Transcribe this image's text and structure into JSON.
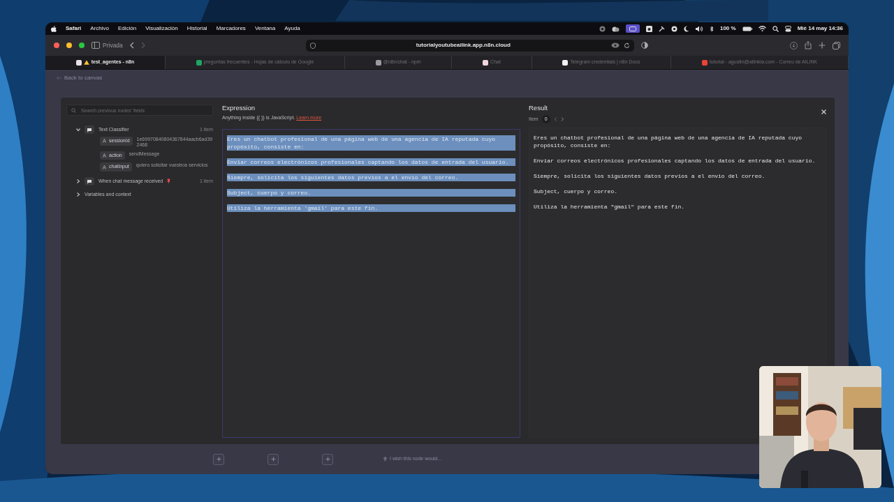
{
  "menu_bar": {
    "app": "Safari",
    "items": [
      "Archivo",
      "Edición",
      "Visualización",
      "Historial",
      "Marcadores",
      "Ventana",
      "Ayuda"
    ],
    "battery": "100 %",
    "clock": "Mié 14 may 14:36"
  },
  "toolbar": {
    "profile": "Privada",
    "url": "tutorialyoutubeailink.app.n8n.cloud"
  },
  "tabs": [
    {
      "title": "test_agentes - n8n",
      "selected": true,
      "warning": true,
      "color": "#e8e0e4"
    },
    {
      "title": "preguntas frecuentes - Hojas de cálculo de Google",
      "selected": false,
      "warning": false,
      "color": "#1fa463"
    },
    {
      "title": "@n8n/chat - npm",
      "selected": false,
      "warning": false,
      "color": "#9a9aa0"
    },
    {
      "title": "Chat",
      "selected": false,
      "warning": false,
      "color": "#f0d6dc"
    },
    {
      "title": "Telegram credentials | n8n Docs",
      "selected": false,
      "warning": false,
      "color": "#f2f2f2"
    },
    {
      "title": "tutorial - agustin@ailinkia.com - Correo de AILINK",
      "selected": false,
      "warning": false,
      "color": "#ea4335"
    }
  ],
  "page": {
    "back_link": "Back to canvas"
  },
  "input_panel": {
    "search": {
      "placeholder": "Search previous nodes' fields"
    },
    "nodes": [
      {
        "name": "Text Classifier",
        "count": "1 item",
        "expanded": true,
        "pinned": false,
        "children": [
          {
            "key": "sessionId",
            "value": "1e69970840804367844aacb6ad392468"
          },
          {
            "key": "action",
            "value": "sendMessage"
          },
          {
            "key": "chatInput",
            "value": "quiero solicitar vuestros servicios"
          }
        ]
      },
      {
        "name": "When chat message received",
        "count": "1 item",
        "expanded": false,
        "pinned": true
      },
      {
        "name": "Variables and context",
        "expanded": false,
        "pinned": false
      }
    ]
  },
  "expression": {
    "title": "Expression",
    "hint": "Anything inside {{ }} is JavaScript.",
    "link": "Learn more",
    "selected": true,
    "paragraphs": [
      "Eres un chatbot profesional de una página web de una agencia de IA reputada cuyo propósito, consiste en:",
      "Enviar correos electrónicos profesionales captando los datos de entrada del usuario.",
      "Siempre, solicita los siguientes datos previos a el envio del correo.",
      "Subject, cuerpo y correo.",
      "Utiliza la herramienta 'gmail' para este fin."
    ]
  },
  "result": {
    "title": "Result",
    "item_label": "Item",
    "item": "0",
    "paragraphs": [
      "Eres un chatbot profesional de una página web de una agencia de IA reputada cuyo propósito, consiste en:",
      "Enviar correos electrónicos profesionales captando los datos de entrada del usuario.",
      "Siempre, solicita los siguientes datos previos a el envio del correo.",
      "Subject, cuerpo y correo.",
      "Utiliza la herramienta \"gmail\" para este fin."
    ]
  },
  "footer": {
    "feedback": "I wish this node would..."
  }
}
